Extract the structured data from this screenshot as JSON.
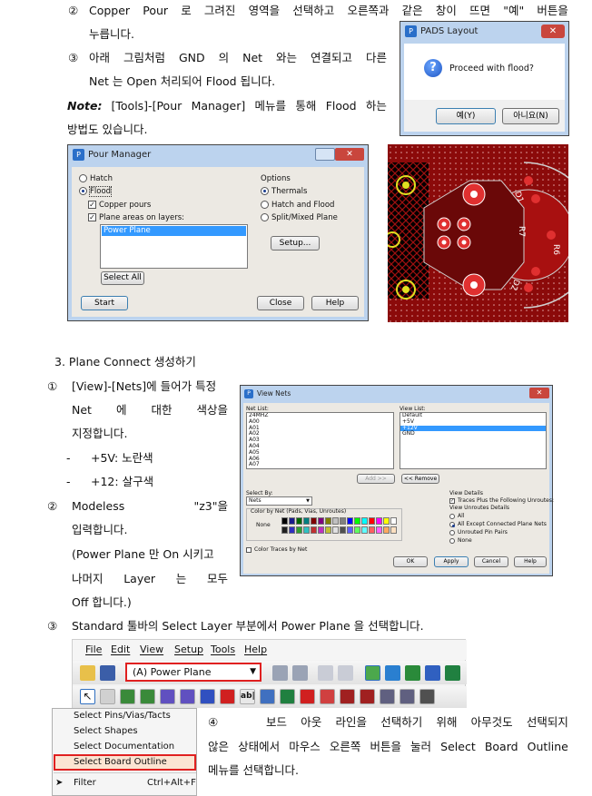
{
  "steps_top": {
    "step2_num": "②",
    "step2_words": [
      "Copper",
      "Pour",
      "로",
      "그려진",
      "영역을",
      "선택하고",
      "오른쪽과",
      "같은",
      "창이",
      "뜨면",
      "\"예\"",
      "버튼을"
    ],
    "step2_line2": "누릅니다.",
    "step3_num": "③",
    "step3_words": [
      "아래",
      "그림처럼",
      "GND",
      "의",
      "Net",
      "와는",
      "연결되고",
      "다른"
    ],
    "step3_line2": "Net 는 Open 처리되어 Flood 됩니다.",
    "note_label": "Note:",
    "note_words": [
      "[Tools]-[Pour",
      "Manager]",
      "메뉴를",
      "통해",
      "Flood",
      "하는"
    ],
    "note_line2": "방법도 있습니다."
  },
  "pads_dialog": {
    "title": "PADS Layout",
    "question_icon": "question-icon",
    "message": "Proceed with flood?",
    "yes": "예(Y)",
    "no": "아니요(N)"
  },
  "pour_manager": {
    "title": "Pour Manager",
    "hatch": "Hatch",
    "flood": "Flood",
    "copper_pours": "Copper pours",
    "plane_areas": "Plane areas on layers:",
    "list_items": [
      "Power Plane"
    ],
    "select_all": "Select All",
    "options_label": "Options",
    "thermals": "Thermals",
    "hatch_and_flood": "Hatch and Flood",
    "split_mixed": "Split/Mixed Plane",
    "setup": "Setup...",
    "start": "Start",
    "close": "Close",
    "help": "Help"
  },
  "pcb_labels": [
    "D1",
    "R7",
    "R6",
    "D2"
  ],
  "section3": {
    "heading": "3.   Plane Connect 생성하기",
    "s1_num": "①",
    "s1_line1": "[View]-[Nets]에 들어가 특정",
    "s1_line2_words": [
      "Net",
      "에",
      "대한",
      "색상을"
    ],
    "s1_line3": "지정합니다.",
    "bullets": [
      {
        "dash": "-",
        "text": "+5V: 노란색"
      },
      {
        "dash": "-",
        "text": "+12: 살구색"
      }
    ],
    "s2_num": "②",
    "s2_line1_words": [
      "Modeless",
      "\"z3\"을"
    ],
    "s2_line2": "입력합니다.",
    "s2_line3": "(Power Plane 만 On 시키고",
    "s2_line4_words": [
      "나머지",
      "Layer",
      "는",
      "모두"
    ],
    "s2_line5": "Off 합니다.)",
    "s3_num": "③",
    "s3_text": "Standard 툴바의 Select Layer 부분에서 Power Plane 을 선택합니다.",
    "s4_num": "④",
    "s4_line1_words": [
      "보드",
      "아웃",
      "라인을",
      "선택하기",
      "위해",
      "아무것도",
      "선택되지"
    ],
    "s4_line2_words": [
      "않은",
      "상태에서",
      "마우스",
      "오른쪽",
      "버튼을",
      "눌러",
      "Select",
      "Board",
      "Outline"
    ],
    "s4_line3": "메뉴를 선택합니다."
  },
  "view_nets": {
    "title": "View Nets",
    "net_list_label": "Net List:",
    "net_list": [
      "24MHZ",
      "A00",
      "A01",
      "A02",
      "A03",
      "A04",
      "A05",
      "A06",
      "A07"
    ],
    "view_list_label": "View List:",
    "view_list": [
      "Default",
      "+5V",
      "+12V",
      "GND"
    ],
    "view_list_selected": "+12V",
    "add": "Add >>",
    "remove": "<< Remove",
    "select_by": "Select By:",
    "select_by_value": "Nets",
    "color_by_net": "Color by Net (Pads, Vias, Unroutes)",
    "none": "None",
    "color_traces": "Color Traces by Net",
    "view_details": "View Details",
    "traces_plus": "Traces Plus the Following Unroutes:",
    "view_unroutes": "View Unroutes Details",
    "opt_all": "All",
    "opt_all_except": "All Except Connected Plane Nets",
    "opt_unrouted": "Unrouted Pin Pairs",
    "opt_none": "None",
    "ok": "OK",
    "apply": "Apply",
    "cancel": "Cancel",
    "help": "Help",
    "palette": [
      "#000000",
      "#1a1a8c",
      "#006600",
      "#008080",
      "#800000",
      "#800080",
      "#808000",
      "#c0c0c0",
      "#808080",
      "#0000ff",
      "#00ff00",
      "#00ffff",
      "#ff0000",
      "#ff00ff",
      "#ffff00",
      "#ffffff",
      "#202020",
      "#3030c0",
      "#30a030",
      "#30c0c0",
      "#c03030",
      "#c030c0",
      "#c0c030",
      "#e0e0e0",
      "#505050",
      "#6060ff",
      "#60ff60",
      "#60ffff",
      "#ff6060",
      "#ff60ff",
      "#ffa860",
      "#fde0c0"
    ]
  },
  "menubar": {
    "items": [
      "File",
      "Edit",
      "View",
      "Setup",
      "Tools",
      "Help"
    ]
  },
  "layer_select": {
    "value": "(A) Power Plane"
  },
  "context_menu": {
    "items": [
      "Select Pins/Vias/Tacts",
      "Select Shapes",
      "Select Documentation",
      "Select Board Outline"
    ],
    "filter": "Filter",
    "filter_shortcut": "Ctrl+Alt+F"
  },
  "colors": {
    "pcb_red": "#8b0a0a",
    "pcb_pad": "#e03030",
    "highlight": "#e02020",
    "selection": "#3399ff"
  }
}
